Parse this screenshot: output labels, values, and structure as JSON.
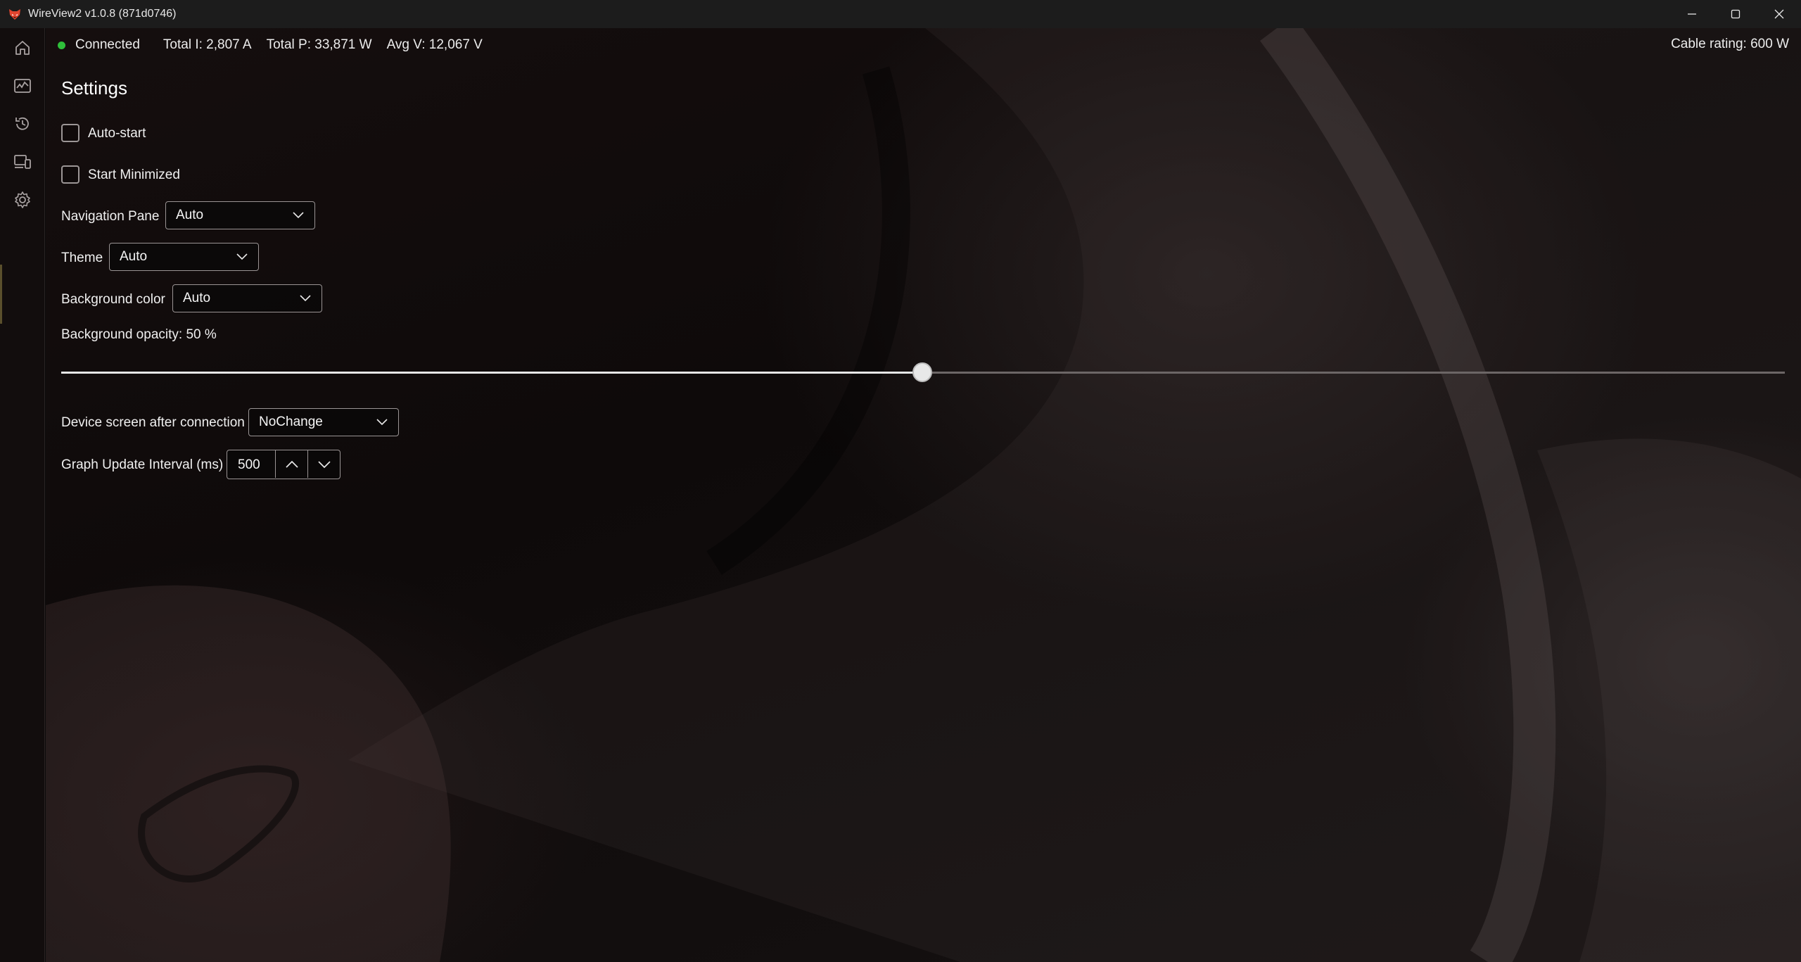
{
  "window": {
    "title": "WireView2 v1.0.8 (871d0746)",
    "app_icon": "fox-logo-icon",
    "controls": [
      "minimize-icon",
      "maximize-icon",
      "close-icon"
    ]
  },
  "nav": {
    "items": [
      {
        "name": "home",
        "icon": "home-icon"
      },
      {
        "name": "monitor",
        "icon": "monitor-graph-icon"
      },
      {
        "name": "history",
        "icon": "history-icon"
      },
      {
        "name": "devices",
        "icon": "devices-icon"
      },
      {
        "name": "settings",
        "icon": "gear-icon"
      }
    ]
  },
  "status": {
    "connection": "Connected",
    "connection_color": "#2fbf3a",
    "total_current": "Total I: 2,807 A",
    "total_power": "Total P: 33,871 W",
    "avg_voltage": "Avg V: 12,067 V",
    "cable_rating": "Cable rating: 600 W"
  },
  "settings": {
    "title": "Settings",
    "auto_start": {
      "label": "Auto-start",
      "checked": false
    },
    "start_minimized": {
      "label": "Start Minimized",
      "checked": false
    },
    "navigation_pane": {
      "label": "Navigation Pane",
      "value": "Auto"
    },
    "theme": {
      "label": "Theme",
      "value": "Auto"
    },
    "background_color": {
      "label": "Background color",
      "value": "Auto"
    },
    "background_opacity": {
      "label": "Background opacity: 50 %",
      "value_percent": 50
    },
    "device_screen": {
      "label": "Device screen after connection",
      "value": "NoChange"
    },
    "graph_interval": {
      "label": "Graph Update Interval (ms)",
      "value": "500"
    }
  }
}
